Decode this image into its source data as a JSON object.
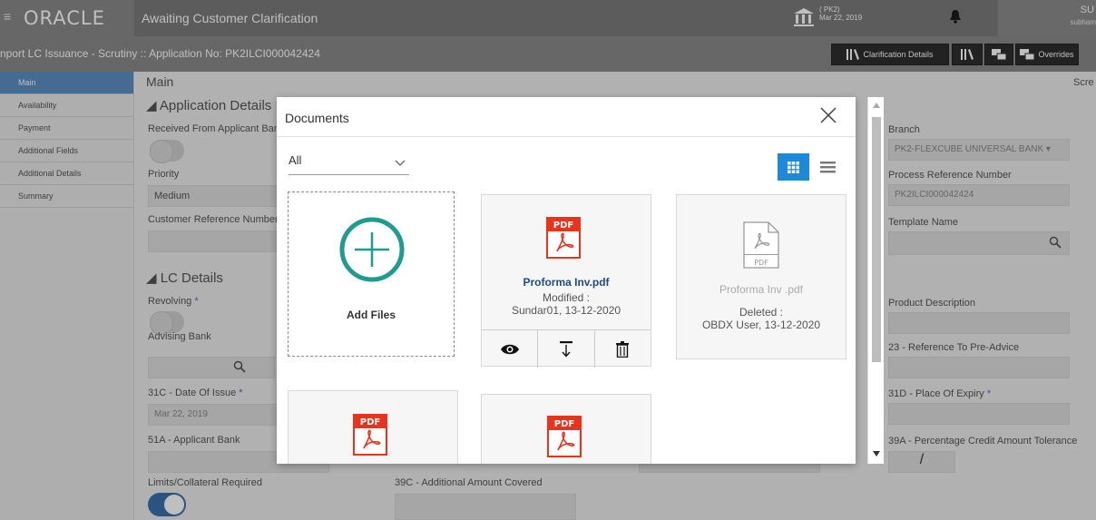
{
  "header": {
    "logo": "ORACLE",
    "title": "Awaiting Customer Clarification",
    "branch_code": "( PK2)",
    "branch_date": "Mar 22, 2019",
    "user_short": "SU",
    "user_name": "subham"
  },
  "subheader": {
    "app_title": "nport LC Issuance - Scrutiny :: Application No: PK2ILCI000042424",
    "clarification_details": "Clarification Details",
    "overrides": "Overrides"
  },
  "sidebar": {
    "items": [
      {
        "label": "Main"
      },
      {
        "label": "Availability"
      },
      {
        "label": "Payment"
      },
      {
        "label": "Additional Fields"
      },
      {
        "label": "Additional Details"
      },
      {
        "label": "Summary"
      }
    ]
  },
  "form": {
    "section_main": "Main",
    "screen_label": "Scre",
    "app_details": "◢ Application Details",
    "received_from": "Received From Applicant Ban",
    "priority_label": "Priority",
    "priority_value": "Medium",
    "cust_ref": "Customer Reference Number",
    "lc_details": "◢ LC Details",
    "revolving": "Revolving",
    "advising_bank": "Advising Bank",
    "date_issue": "31C - Date Of Issue",
    "date_issue_value": "Mar 22, 2019",
    "applicant_bank": "51A - Applicant Bank",
    "limits": "Limits/Collateral Required",
    "additional_amount": "39C - Additional Amount Covered",
    "branch_label": "Branch",
    "branch_value": "PK2-FLEXCUBE UNIVERSAL BANK",
    "process_ref_label": "Process Reference Number",
    "process_ref_value": "PK2ILCI000042424",
    "template_label": "Template Name",
    "product_desc": "Product Description",
    "ref_advice": "23 - Reference To Pre-Advice",
    "place_expiry": "31D - Place Of Expiry",
    "pct_tolerance": "39A - Percentage Credit Amount Tolerance",
    "tolerance_sep": "/",
    "required_mark": "*"
  },
  "modal": {
    "title": "Documents",
    "filter_value": "All",
    "add_files": "Add Files",
    "files": [
      {
        "name": "Proforma Inv.pdf",
        "status": "Modified :",
        "by": "Sundar01, 13-12-2020",
        "badge": "PDF"
      },
      {
        "name": "Proforma Inv .pdf",
        "status": "Deleted :",
        "by": "OBDX User, 13-12-2020",
        "badge": "PDF"
      },
      {
        "badge": "PDF"
      },
      {
        "badge": "PDF"
      }
    ]
  },
  "colors": {
    "accent": "#1d8ad8",
    "pdf_red": "#e8341c",
    "add_teal": "#1f9c8f"
  }
}
